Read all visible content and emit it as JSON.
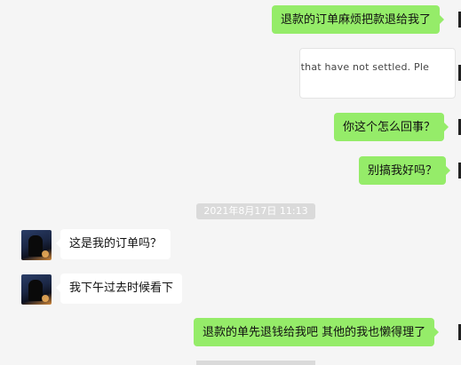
{
  "messages": [
    {
      "text": "退款的订单麻烦把款退给我了"
    },
    {
      "card_text": "e that have not settled. Ple"
    },
    {
      "text": "你这个怎么回事？"
    },
    {
      "text": "别搞我好吗？"
    },
    {
      "timestamp": "2021年8月17日 11:13"
    },
    {
      "text": "这是我的订单吗？"
    },
    {
      "text": "我下午过去时候看下"
    },
    {
      "text": "退款的单先退钱给我吧 其他的我也懒得理了"
    }
  ]
}
